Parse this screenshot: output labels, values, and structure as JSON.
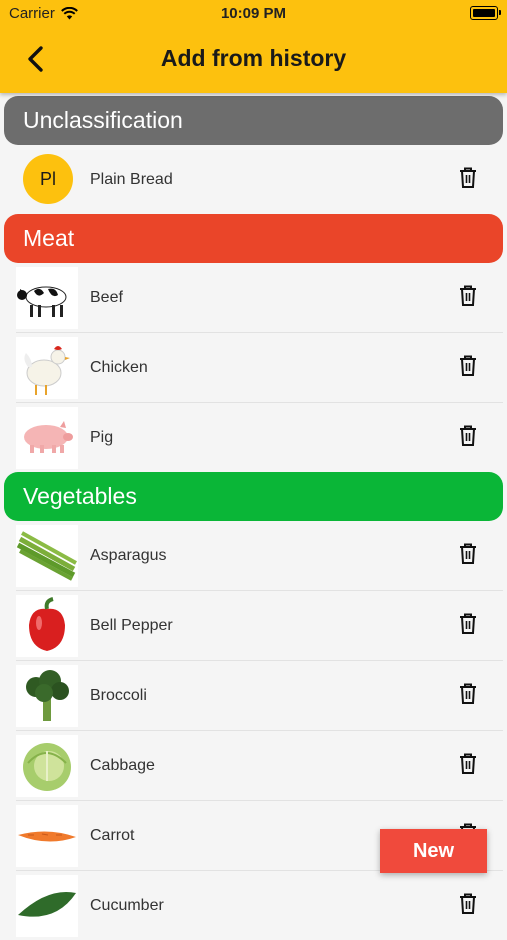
{
  "status_bar": {
    "carrier": "Carrier",
    "time": "10:09 PM"
  },
  "header": {
    "title": "Add from history"
  },
  "sections": [
    {
      "name": "Unclassification",
      "color": "#6d6d6d",
      "items": [
        {
          "label": "Plain Bread",
          "avatar": "Pl"
        }
      ]
    },
    {
      "name": "Meat",
      "color": "#ea4529",
      "items": [
        {
          "label": "Beef",
          "icon": "cow-icon"
        },
        {
          "label": "Chicken",
          "icon": "chicken-icon"
        },
        {
          "label": "Pig",
          "icon": "pig-icon"
        }
      ]
    },
    {
      "name": "Vegetables",
      "color": "#0ab637",
      "items": [
        {
          "label": "Asparagus",
          "icon": "asparagus-icon"
        },
        {
          "label": "Bell Pepper",
          "icon": "bell-pepper-icon"
        },
        {
          "label": "Broccoli",
          "icon": "broccoli-icon"
        },
        {
          "label": "Cabbage",
          "icon": "cabbage-icon"
        },
        {
          "label": "Carrot",
          "icon": "carrot-icon"
        },
        {
          "label": "Cucumber",
          "icon": "cucumber-icon"
        }
      ]
    }
  ],
  "fab": {
    "label": "New",
    "color": "#f04a3c"
  },
  "accent": "#fdc10e"
}
